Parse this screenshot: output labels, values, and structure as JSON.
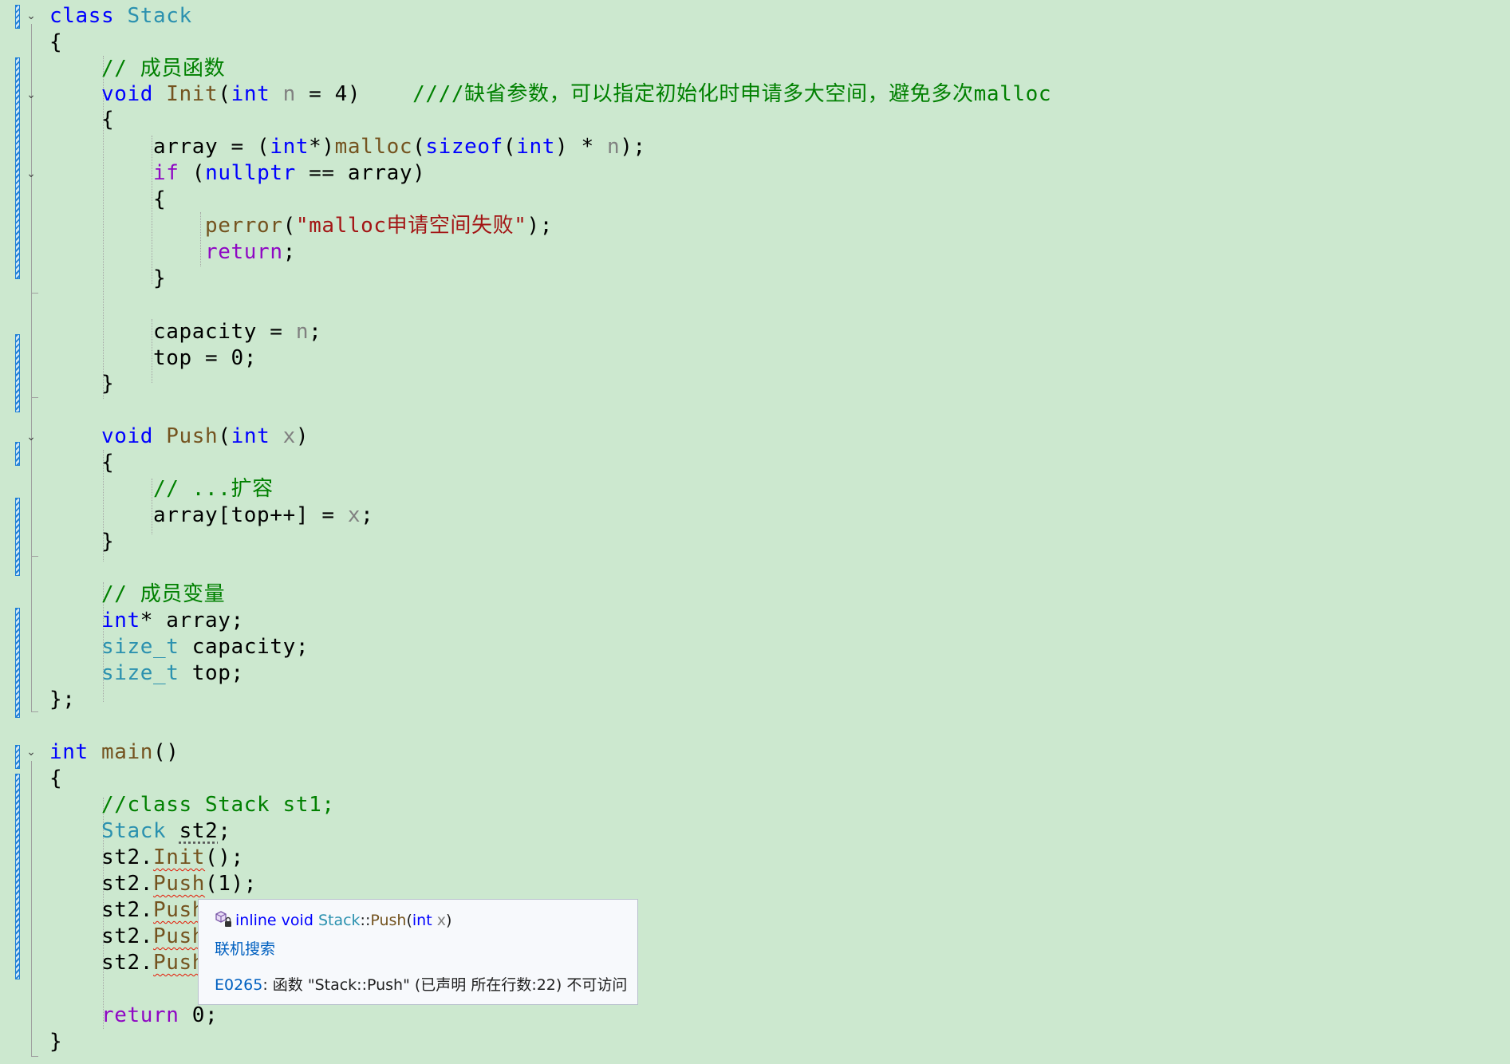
{
  "colors": {
    "background": "#cce8cf",
    "keyword": "#0000ff",
    "type": "#2b91af",
    "function": "#74531f",
    "control": "#8f08c4",
    "comment": "#008000",
    "string": "#a31515",
    "parameter": "#808080",
    "error_squiggle": "#e51400",
    "change_marker": "#1e7fd6"
  },
  "code": {
    "l1": {
      "t0": "class",
      "t1": " ",
      "t2": "Stack"
    },
    "l2": {
      "t0": "{"
    },
    "l3": {
      "t0": "    ",
      "t1": "// 成员函数"
    },
    "l4": {
      "t0": "    ",
      "t1": "void",
      "t2": " ",
      "t3": "Init",
      "t4": "(",
      "t5": "int",
      "t6": " ",
      "t7": "n",
      "t8": " = 4)    ",
      "t9": "////缺省参数，可以指定初始化时申请多大空间，避免多次malloc"
    },
    "l5": {
      "t0": "    {"
    },
    "l6": {
      "t0": "        array = (",
      "t1": "int",
      "t2": "*)",
      "t3": "malloc",
      "t4": "(",
      "t5": "sizeof",
      "t6": "(",
      "t7": "int",
      "t8": ") * ",
      "t9": "n",
      "t10": ");"
    },
    "l7": {
      "t0": "        ",
      "t1": "if",
      "t2": " (",
      "t3": "nullptr",
      "t4": " == array)"
    },
    "l8": {
      "t0": "        {"
    },
    "l9": {
      "t0": "            ",
      "t1": "perror",
      "t2": "(",
      "t3": "\"malloc申请空间失败\"",
      "t4": ");"
    },
    "l10": {
      "t0": "            ",
      "t1": "return",
      "t2": ";"
    },
    "l11": {
      "t0": "        }"
    },
    "l12": {
      "t0": ""
    },
    "l13": {
      "t0": "        capacity = ",
      "t1": "n",
      "t2": ";"
    },
    "l14": {
      "t0": "        top = 0;"
    },
    "l15": {
      "t0": "    }"
    },
    "l16": {
      "t0": ""
    },
    "l17": {
      "t0": "    ",
      "t1": "void",
      "t2": " ",
      "t3": "Push",
      "t4": "(",
      "t5": "int",
      "t6": " ",
      "t7": "x",
      "t8": ")"
    },
    "l18": {
      "t0": "    {"
    },
    "l19": {
      "t0": "        ",
      "t1": "// ...扩容"
    },
    "l20": {
      "t0": "        array[top++] = ",
      "t1": "x",
      "t2": ";"
    },
    "l21": {
      "t0": "    }"
    },
    "l22": {
      "t0": ""
    },
    "l23": {
      "t0": "    ",
      "t1": "// 成员变量"
    },
    "l24": {
      "t0": "    ",
      "t1": "int",
      "t2": "* array;"
    },
    "l25": {
      "t0": "    ",
      "t1": "size_t",
      "t2": " capacity;"
    },
    "l26": {
      "t0": "    ",
      "t1": "size_t",
      "t2": " top;"
    },
    "l27": {
      "t0": "};"
    },
    "l28": {
      "t0": ""
    },
    "l29": {
      "t0": "int",
      "t1": " ",
      "t2": "main",
      "t3": "()"
    },
    "l30": {
      "t0": "{"
    },
    "l31": {
      "t0": "    ",
      "t1": "//class Stack st1;"
    },
    "l32": {
      "t0": "    ",
      "t1": "Stack",
      "t2": " ",
      "t3": "st2",
      "t4": ";"
    },
    "l33": {
      "t0": "    st2.",
      "t1": "Init",
      "t2": "();"
    },
    "l34": {
      "t0": "    st2.",
      "t1": "Push",
      "t2": "(1);"
    },
    "l35": {
      "t0": "    st2.",
      "t1": "Push"
    },
    "l36": {
      "t0": "    st2.",
      "t1": "Push"
    },
    "l37": {
      "t0": "    st2.",
      "t1": "Push"
    },
    "l38": {
      "t0": ""
    },
    "l39": {
      "t0": "    ",
      "t1": "return",
      "t2": " 0;"
    },
    "l40": {
      "t0": "}"
    }
  },
  "tooltip": {
    "icon": "method-private-icon",
    "signature": {
      "s0": "inline",
      "s1": " ",
      "s2": "void",
      "s3": " ",
      "s4": "Stack",
      "s5": "::",
      "s6": "Push",
      "s7": "(",
      "s8": "int",
      "s9": " ",
      "s10": "x",
      "s11": ")"
    },
    "search_link": "联机搜索",
    "error_code": "E0265",
    "error_message": ": 函数 \"Stack::Push\" (已声明 所在行数:22) 不可访问"
  }
}
